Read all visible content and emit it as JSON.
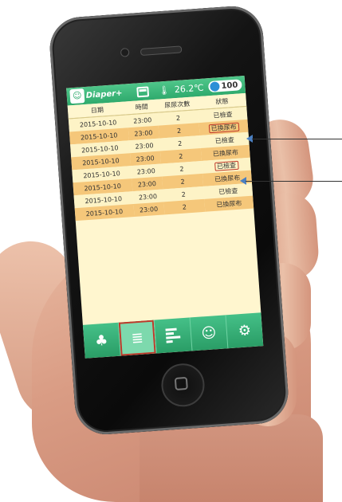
{
  "app": {
    "logo_mark": "☺",
    "logo_text": "Diaper+",
    "temperature": "26.2℃",
    "counter": "100"
  },
  "table": {
    "headers": [
      "日期",
      "時間",
      "尿尿次數",
      "狀態"
    ],
    "rows": [
      {
        "date": "2015-10-10",
        "time": "23:00",
        "count": "2",
        "status": "已檢查",
        "highlight": false
      },
      {
        "date": "2015-10-10",
        "time": "23:00",
        "count": "2",
        "status": "已換尿布",
        "highlight": true
      },
      {
        "date": "2015-10-10",
        "time": "23:00",
        "count": "2",
        "status": "已檢查",
        "highlight": false
      },
      {
        "date": "2015-10-10",
        "time": "23:00",
        "count": "2",
        "status": "已換尿布",
        "highlight": false
      },
      {
        "date": "2015-10-10",
        "time": "23:00",
        "count": "2",
        "status": "已檢查",
        "highlight": true
      },
      {
        "date": "2015-10-10",
        "time": "23:00",
        "count": "2",
        "status": "已換尿布",
        "highlight": false
      },
      {
        "date": "2015-10-10",
        "time": "23:00",
        "count": "2",
        "status": "已檢查",
        "highlight": false
      },
      {
        "date": "2015-10-10",
        "time": "23:00",
        "count": "2",
        "status": "已換尿布",
        "highlight": false
      }
    ]
  },
  "tabs": [
    {
      "name": "tab-baby",
      "icon": "baby-icon",
      "glyph": "♣",
      "active": false
    },
    {
      "name": "tab-records",
      "icon": "list-icon",
      "glyph": "≣",
      "active": true
    },
    {
      "name": "tab-chart",
      "icon": "bar-chart-icon",
      "glyph": "",
      "active": false
    },
    {
      "name": "tab-smile",
      "icon": "smiley-icon",
      "glyph": "☺",
      "active": false
    },
    {
      "name": "tab-settings",
      "icon": "gear-icon",
      "glyph": "⚙",
      "active": false
    }
  ],
  "colors": {
    "accent": "#2faa6d",
    "row_alt": "#f5c77a",
    "highlight_box": "#c0392b"
  }
}
